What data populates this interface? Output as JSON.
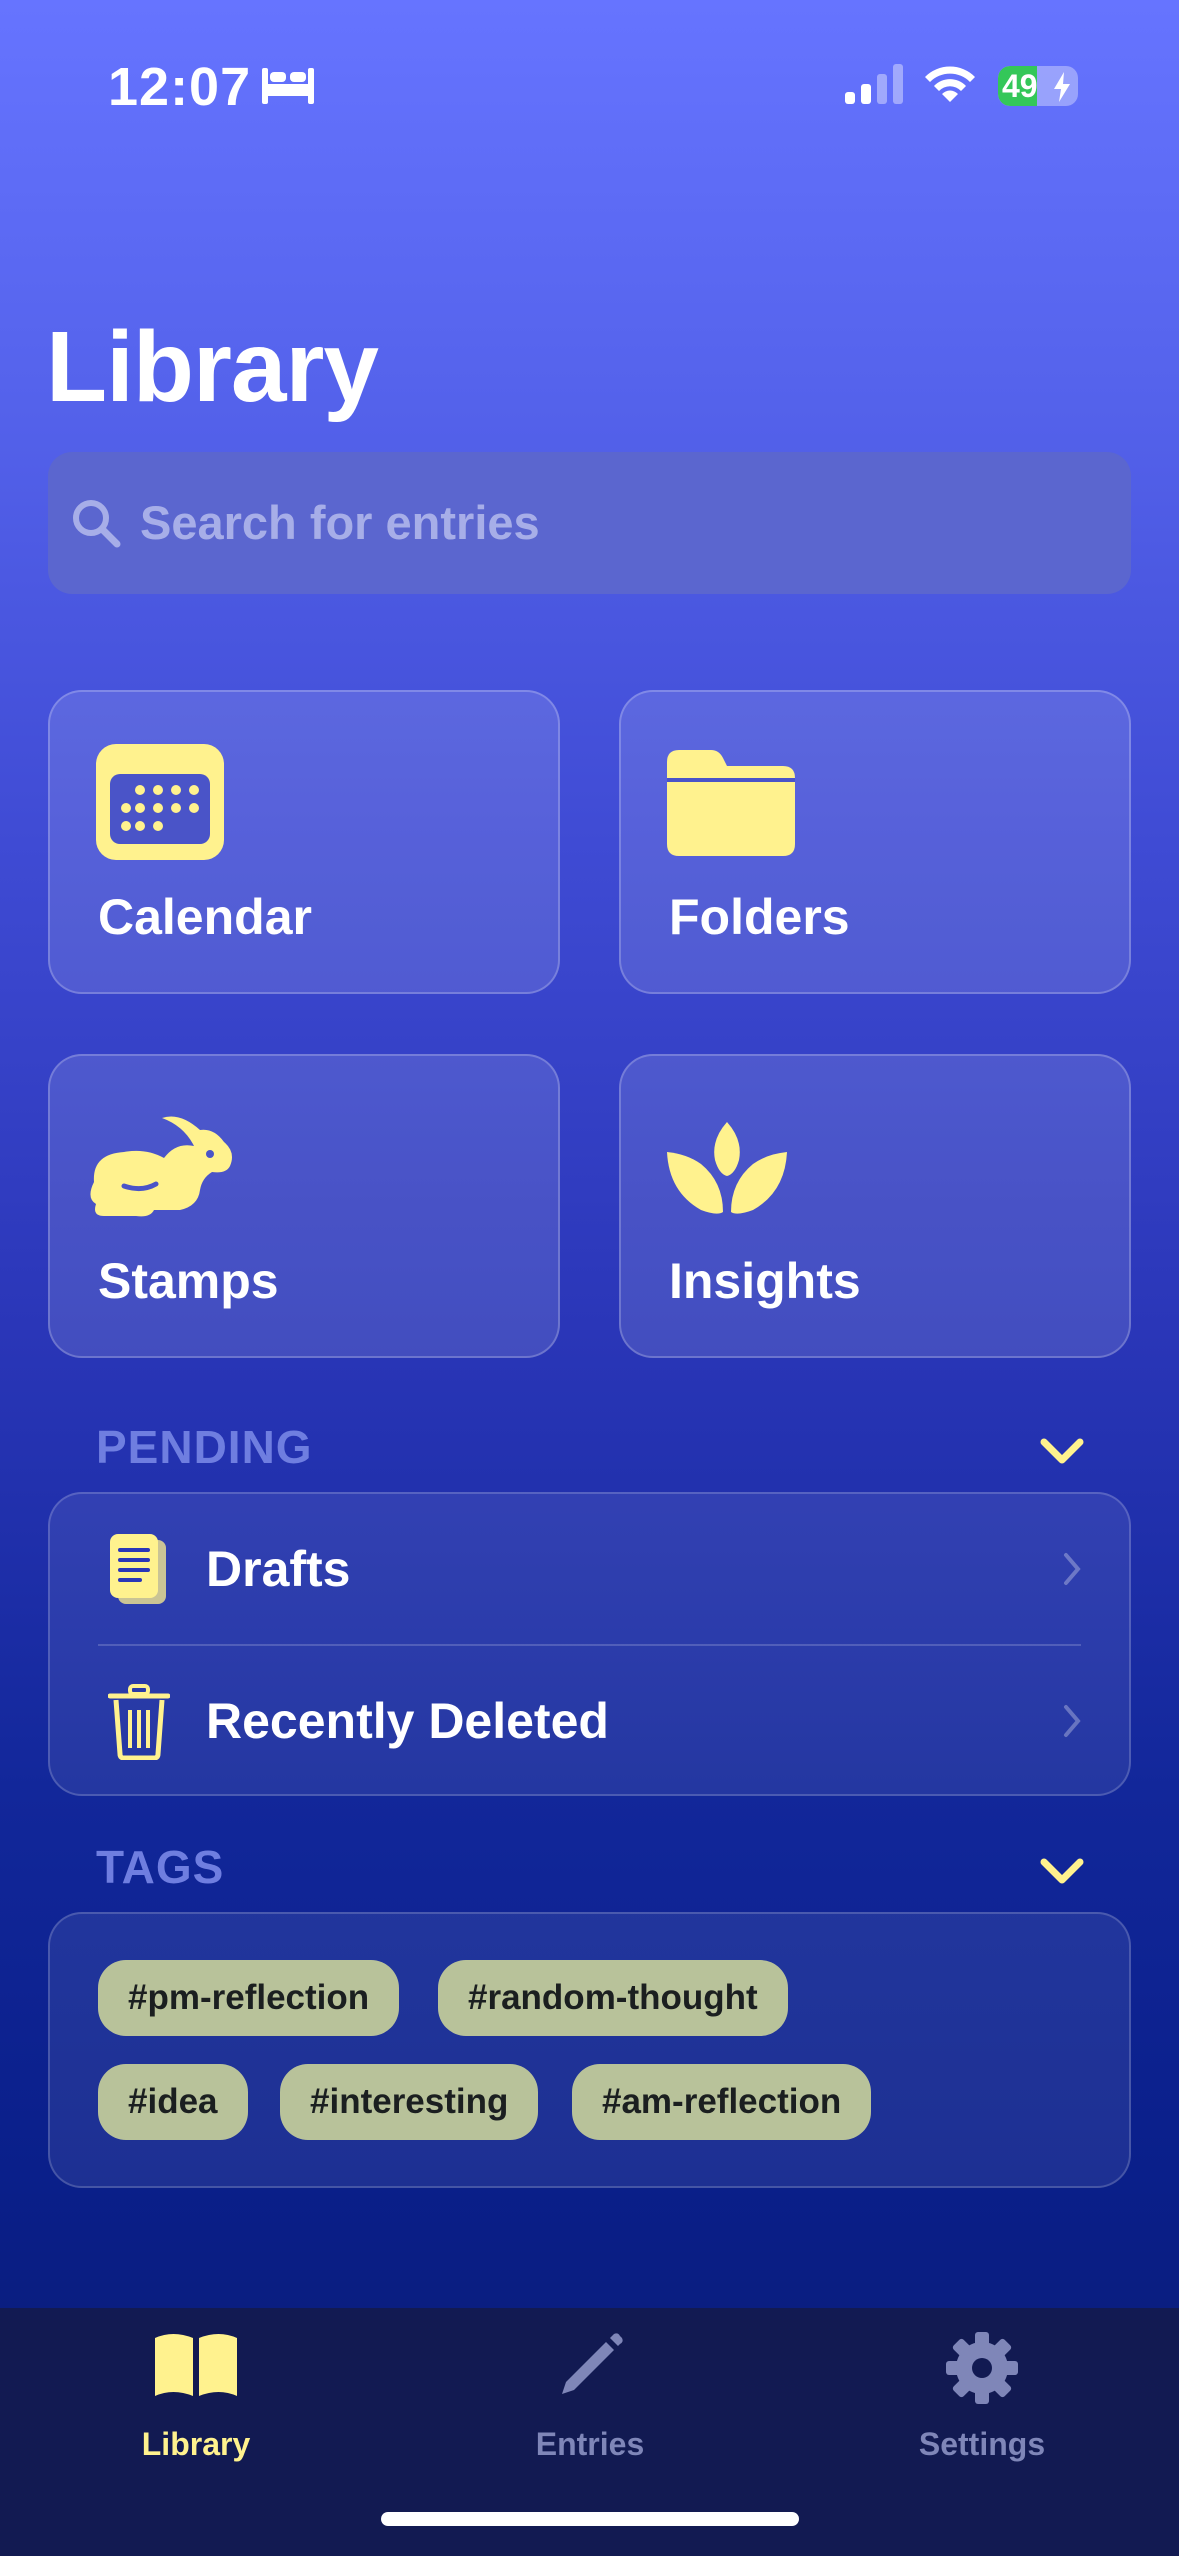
{
  "status_bar": {
    "time": "12:07",
    "battery_level": "49",
    "battery_fraction": 0.49,
    "icons": [
      "bed-icon",
      "signal-icon",
      "wifi-icon",
      "battery-icon",
      "bolt-icon"
    ]
  },
  "header": {
    "title": "Library"
  },
  "search": {
    "placeholder": "Search for entries"
  },
  "cards": [
    {
      "label": "Calendar",
      "icon": "calendar-icon"
    },
    {
      "label": "Folders",
      "icon": "folder-icon"
    },
    {
      "label": "Stamps",
      "icon": "rabbit-icon"
    },
    {
      "label": "Insights",
      "icon": "leaf-icon"
    }
  ],
  "pending": {
    "title": "PENDING",
    "items": [
      {
        "label": "Drafts",
        "icon": "drafts-icon"
      },
      {
        "label": "Recently Deleted",
        "icon": "trash-icon"
      }
    ]
  },
  "tags": {
    "title": "TAGS",
    "items": [
      "#pm-reflection",
      "#random-thought",
      "#idea",
      "#interesting",
      "#am-reflection"
    ]
  },
  "tabbar": {
    "tabs": [
      {
        "label": "Library",
        "icon": "book-icon",
        "active": true
      },
      {
        "label": "Entries",
        "icon": "pencil-icon",
        "active": false
      },
      {
        "label": "Settings",
        "icon": "gear-icon",
        "active": false
      }
    ]
  },
  "colors": {
    "accent": "#fff28e",
    "tag_bg": "#b8c29a",
    "inactive_tab": "#7f86b8",
    "battery_green": "#34c759"
  }
}
